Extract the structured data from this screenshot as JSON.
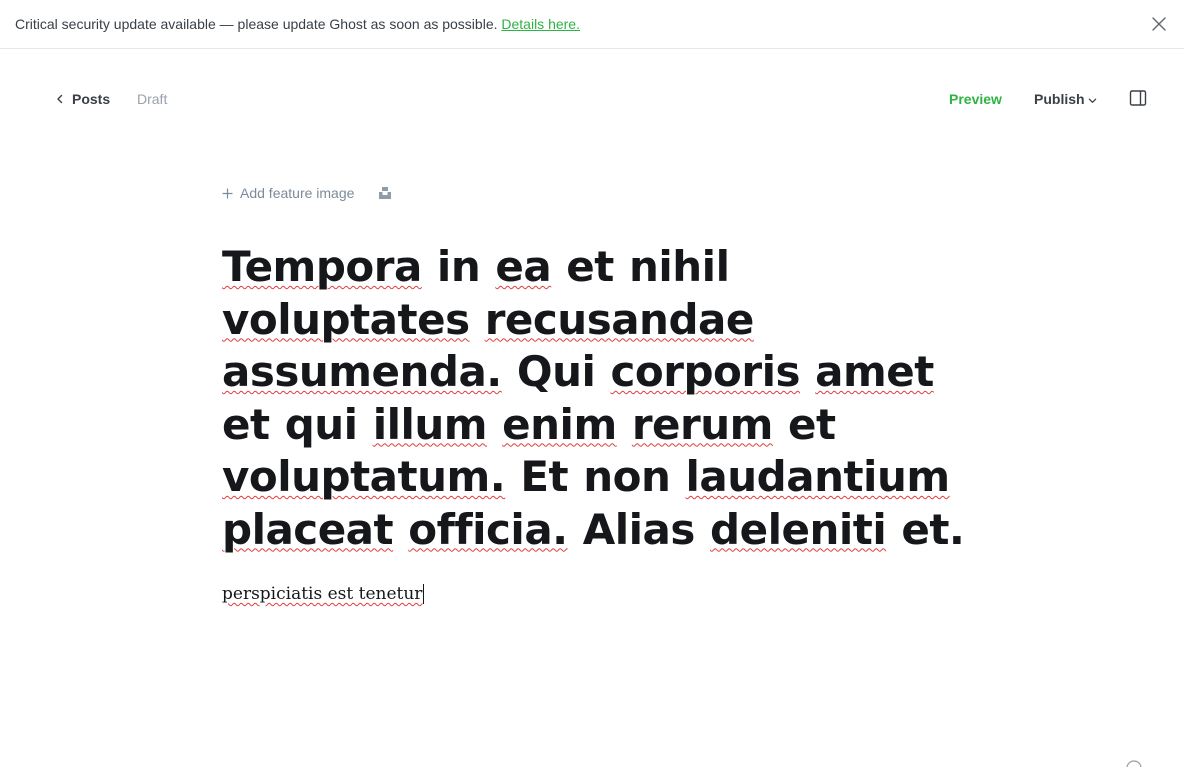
{
  "banner": {
    "message": "Critical security update available — please update Ghost as soon as possible.",
    "link_label": "Details here.",
    "close_icon": "close-icon",
    "link_color": "#2fb344"
  },
  "editor_nav": {
    "back_label": "Posts",
    "status": "Draft",
    "preview_label": "Preview",
    "publish_label": "Publish",
    "sidebar_icon": "sidebar-toggle-icon",
    "accent_color": "#2fb344"
  },
  "feature_image": {
    "add_label": "Add feature image",
    "unsplash_icon": "unsplash-icon"
  },
  "post": {
    "title_words": [
      {
        "w": "Tempora",
        "spell": true
      },
      {
        "w": "in",
        "spell": false
      },
      {
        "w": "ea",
        "spell": true
      },
      {
        "w": "et",
        "spell": false
      },
      {
        "w": "nihil",
        "spell": false
      },
      {
        "w": "voluptates",
        "spell": true
      },
      {
        "w": "recusandae",
        "spell": true
      },
      {
        "w": "assumenda.",
        "spell": true
      },
      {
        "w": "Qui",
        "spell": false
      },
      {
        "w": "corporis",
        "spell": true
      },
      {
        "w": "amet",
        "spell": true
      },
      {
        "w": "et",
        "spell": false
      },
      {
        "w": "qui",
        "spell": false
      },
      {
        "w": "illum",
        "spell": true
      },
      {
        "w": "enim",
        "spell": true
      },
      {
        "w": "rerum",
        "spell": true
      },
      {
        "w": "et",
        "spell": false
      },
      {
        "w": "voluptatum.",
        "spell": true
      },
      {
        "w": "Et",
        "spell": false
      },
      {
        "w": "non",
        "spell": false
      },
      {
        "w": "laudantium",
        "spell": true
      },
      {
        "w": "placeat",
        "spell": true
      },
      {
        "w": "officia.",
        "spell": true
      },
      {
        "w": "Alias",
        "spell": false
      },
      {
        "w": "deleniti",
        "spell": true
      },
      {
        "w": "et.",
        "spell": false
      }
    ],
    "body": "perspiciatis est tenetur"
  },
  "footer": {
    "help_icon": "help-icon"
  }
}
